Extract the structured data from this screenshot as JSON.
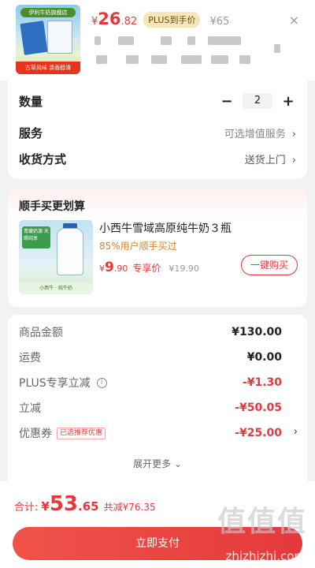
{
  "header": {
    "currency": "¥",
    "price_int": "26",
    "price_dec": ".82",
    "plus_badge": "PLUS到手价",
    "original_price": "¥65",
    "close": "×",
    "thumb_title": "伊利牛奶旗舰店",
    "thumb_ribbon": "古草风味 清香醇滑"
  },
  "quantity": {
    "label": "数量",
    "minus": "−",
    "value": "2",
    "plus": "+"
  },
  "service": {
    "label": "服务",
    "value": "可选增值服务",
    "chevron": "›"
  },
  "delivery": {
    "label": "收货方式",
    "value": "送货上门",
    "chevron": "›"
  },
  "upsell": {
    "title": "顺手买更划算",
    "image_tag": "青藏奶源 天赐纯享",
    "image_strip": "小西牛 · 纯牛奶",
    "name": "小西牛雪域高原纯牛奶３瓶",
    "bought": "85%用户顺手买过",
    "currency": "¥",
    "price_int": "9",
    "price_dec": ".90",
    "exclusive": "专享价",
    "original_price": "¥19.90",
    "buy_button": "一键购买"
  },
  "breakdown": {
    "goods_label": "商品金额",
    "goods_value": "¥130.00",
    "shipping_label": "运费",
    "shipping_value": "¥0.00",
    "plus_label": "PLUS专享立减",
    "plus_value": "-¥1.30",
    "instant_label": "立减",
    "instant_value": "-¥50.05",
    "coupon_label": "优惠券",
    "coupon_tag": "已选推荐优惠",
    "coupon_value": "-¥25.00",
    "coupon_chevron": "›",
    "more": "展开更多 ⌄"
  },
  "footer": {
    "total_label": "合计:",
    "currency": "¥",
    "total_int": "53",
    "total_dec": ".65",
    "saved": "共减¥76.35",
    "pay_button": "立即支付"
  },
  "watermark": {
    "logo": "值值值",
    "url": "zhizhizhi.com"
  },
  "colors": {
    "accent": "#e4393c",
    "plus_badge_bg": "#f7e6b8",
    "bought": "#d9822b"
  }
}
